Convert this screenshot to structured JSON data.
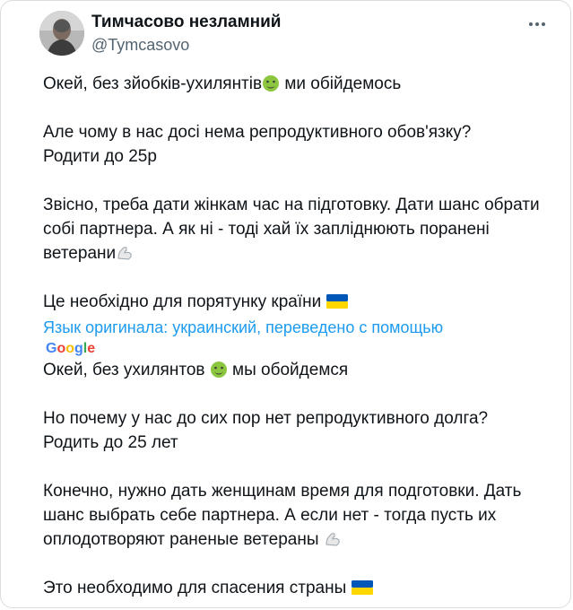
{
  "author": {
    "name": "Тимчасово незламний",
    "handle": "@Tymcasovo"
  },
  "original": {
    "p1_before": "Окей, без зйобків-ухилянтів",
    "p1_after": " ми обійдемось",
    "p2_line1": "Але чому в нас досі нема репродуктивного обов'язку?",
    "p2_line2": "Родити до 25р",
    "p3_text": "Звісно, треба дати жінкам час на підготовку. Дати шанс обрати собі партнера. А як ні - тоді хай їх запліднюють поранені ветерани",
    "p4_text": "Це необхідно для порятунку країни "
  },
  "translation_note": {
    "text": "Язык оригинала: украинский, переведено с помощью",
    "provider": "Google"
  },
  "translated": {
    "p1_before": "Окей, без ухилянтов ",
    "p1_after": " мы обойдемся",
    "p2_line1": "Но почему у нас до сих пор нет репродуктивного долга?",
    "p2_line2": "Родить до 25 лет",
    "p3_text": "Конечно, нужно дать женщинам время для подготовки. Дать шанс выбрать себе партнера. А если нет - тогда пусть их оплодотворяют раненые ветераны ",
    "p4_text": "Это необходимо для спасения страны "
  },
  "icons": {
    "more": "more-options-icon",
    "nauseated": "nauseated-face-emoji",
    "bicep": "flexed-biceps-emoji",
    "flag": "ukraine-flag-emoji"
  },
  "colors": {
    "text": "#0f1419",
    "secondary": "#536471",
    "link": "#1d9bf0",
    "flag_blue": "#0057b7",
    "flag_yellow": "#ffd700"
  }
}
